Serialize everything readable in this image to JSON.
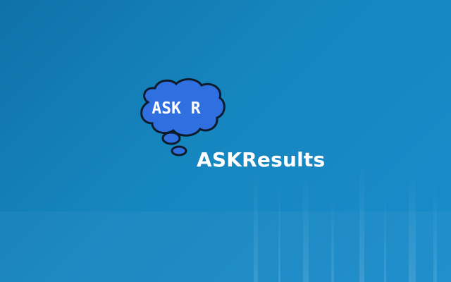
{
  "logo": {
    "text": "ASK R",
    "icon": "thought-bubble-icon",
    "fill_color": "#2f6fe0",
    "outline_color": "#0d1b2a"
  },
  "app": {
    "title": "ASKResults"
  },
  "colors": {
    "background_start": "#0f72a8",
    "background_end": "#1a8ccb",
    "text": "#ffffff"
  }
}
